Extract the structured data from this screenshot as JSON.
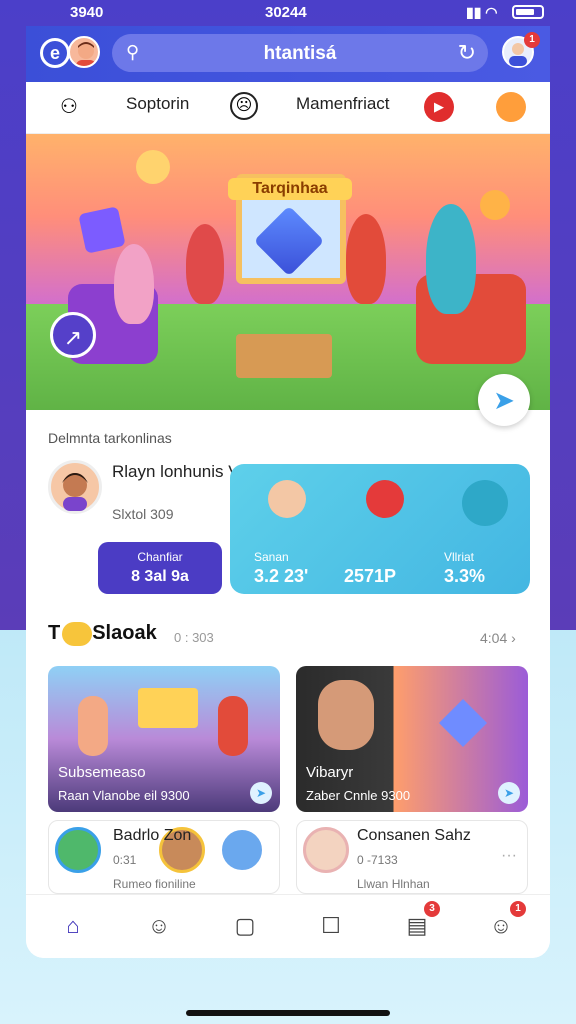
{
  "status": {
    "time": "3940",
    "center": "30244"
  },
  "header": {
    "search_text": "htantisá"
  },
  "nav": {
    "items": [
      "Soptorin",
      "Mamenfriact"
    ]
  },
  "hero": {
    "title": "Tarqinhaa"
  },
  "host": {
    "section_label": "Delmnta tarkonlinas",
    "name": "Rlayn lonhunis Vlctuarl itabgs",
    "meta": "Slxtol 309",
    "join_top": "Chanfiar",
    "join_bottom": "8 3al 9a"
  },
  "stats": [
    {
      "label": "Sanan",
      "value": "3.2 23'"
    },
    {
      "label": "",
      "value": "2571P"
    },
    {
      "label": "Vllriat",
      "value": "3.3%"
    }
  ],
  "section": {
    "title": "T",
    "title_rest": "Slaоak",
    "count": "0 : 303",
    "more": "4:04 ›"
  },
  "tiles": [
    {
      "title": "Subsemeaso",
      "meta": "Raan   Vlanobe eil 9300"
    },
    {
      "title": "Vibaryr",
      "meta": "Zaber   Cnnle 9300"
    }
  ],
  "rows": [
    {
      "title": "Badrlo Zon",
      "meta": "0:31",
      "sub": "Rumeo fioniline"
    },
    {
      "title": "Consanen Sahz",
      "meta": "0 -7133",
      "sub": "Llwan   Hlnhan"
    }
  ],
  "tabbar": {
    "badge1": "3",
    "badge2": "1"
  },
  "profile_badge": "1",
  "colors": {
    "brand": "#3b4fd8",
    "accent": "#4b3cc4",
    "cyan": "#43b6e2"
  }
}
